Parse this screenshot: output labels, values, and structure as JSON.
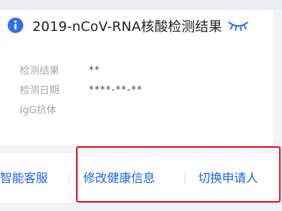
{
  "header": {
    "info_icon": "info-icon",
    "title": "2019-nCoV-RNA核酸检测结果",
    "toggle_icon": "eye-closed-icon"
  },
  "fields": [
    {
      "label": "检测结果",
      "value": "**"
    },
    {
      "label": "检测日期",
      "value": "****-**-**"
    },
    {
      "label": "IgG抗体",
      "value": ""
    }
  ],
  "actions": {
    "customer_service": "智能客服",
    "edit_health_info": "修改健康信息",
    "switch_applicant": "切换申请人"
  },
  "colors": {
    "accent": "#1f64e8",
    "highlight_border": "#e60012",
    "label": "#a3a6ad",
    "value": "#4a4c52"
  }
}
